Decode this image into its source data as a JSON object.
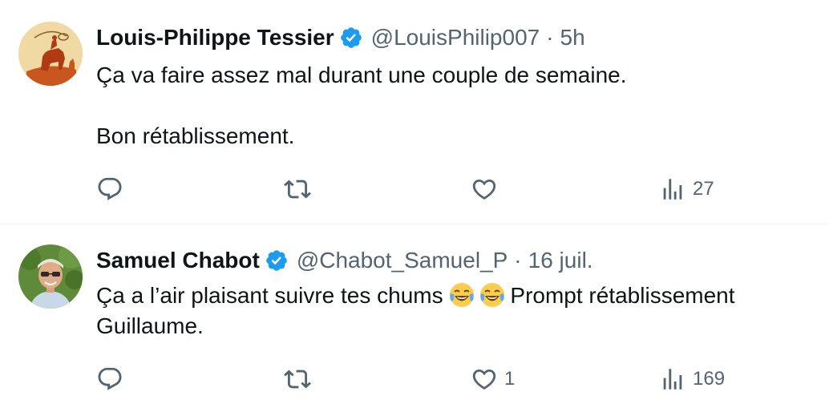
{
  "tweets": [
    {
      "author_name": "Louis-Philippe Tessier",
      "handle": "@LouisPhilip007",
      "separator": "·",
      "time": "5h",
      "body_lines": [
        "Ça va faire assez mal durant une couple de semaine.",
        "Bon rétablissement."
      ],
      "reply_count": "",
      "retweet_count": "",
      "like_count": "",
      "view_count": "27"
    },
    {
      "author_name": "Samuel Chabot",
      "handle": "@Chabot_Samuel_P",
      "separator": "·",
      "time": "16 juil.",
      "body_before_emoji": "Ça a l’air plaisant suivre tes chums ",
      "body_after_emoji": "Prompt rétablissement Guillaume.",
      "emojis": [
        "face-with-tears-of-joy",
        "face-with-tears-of-joy"
      ],
      "reply_count": "",
      "retweet_count": "",
      "like_count": "1",
      "view_count": "169"
    }
  ],
  "icons": {
    "verified": "verified-badge-icon",
    "reply": "reply-icon",
    "retweet": "retweet-icon",
    "like": "heart-icon",
    "views": "views-chart-icon"
  },
  "colors": {
    "text": "#0f1419",
    "secondary": "#536471",
    "verified": "#1d9bf0",
    "divider": "#eff3f4"
  }
}
